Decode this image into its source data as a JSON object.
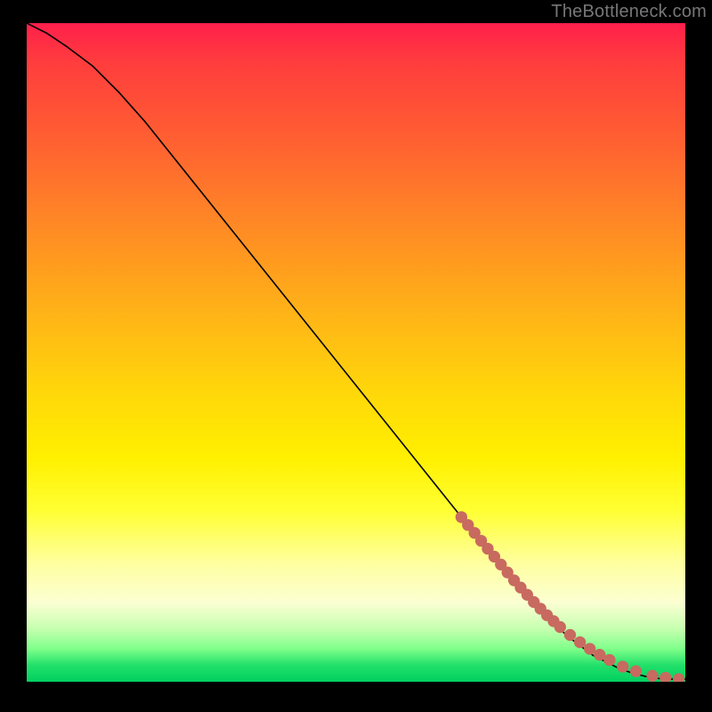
{
  "watermark": "TheBottleneck.com",
  "colors": {
    "background": "#000000",
    "curve": "#000000",
    "marker": "#c86a5f"
  },
  "chart_data": {
    "type": "line",
    "title": "",
    "xlabel": "",
    "ylabel": "",
    "xlim": [
      0,
      100
    ],
    "ylim": [
      0,
      100
    ],
    "grid": false,
    "series": [
      {
        "name": "bottleneck-curve",
        "x": [
          0,
          3,
          6,
          10,
          14,
          18,
          22,
          26,
          30,
          34,
          38,
          42,
          46,
          50,
          54,
          58,
          62,
          66,
          70,
          74,
          78,
          82,
          86,
          88,
          90,
          92,
          94,
          96,
          98,
          100
        ],
        "y": [
          100,
          98.5,
          96.5,
          93.5,
          89.5,
          85,
          80,
          75,
          70,
          65,
          60,
          55,
          50,
          45,
          40,
          35,
          30,
          25,
          20,
          15,
          11,
          7,
          4,
          3,
          2,
          1.3,
          0.8,
          0.5,
          0.4,
          0.4
        ]
      }
    ],
    "markers": {
      "name": "sample-points",
      "x": [
        66,
        67,
        68,
        69,
        70,
        71,
        72,
        73,
        74,
        75,
        76,
        77,
        78,
        79,
        80,
        81,
        82.5,
        84,
        85.5,
        87,
        88.5,
        90.5,
        92.5,
        95,
        97,
        99
      ],
      "y": [
        25,
        23.8,
        22.6,
        21.4,
        20.2,
        19,
        17.8,
        16.6,
        15.4,
        14.3,
        13.2,
        12.1,
        11.1,
        10.1,
        9.2,
        8.3,
        7.1,
        6,
        5,
        4.1,
        3.3,
        2.3,
        1.6,
        0.9,
        0.6,
        0.4
      ]
    }
  }
}
